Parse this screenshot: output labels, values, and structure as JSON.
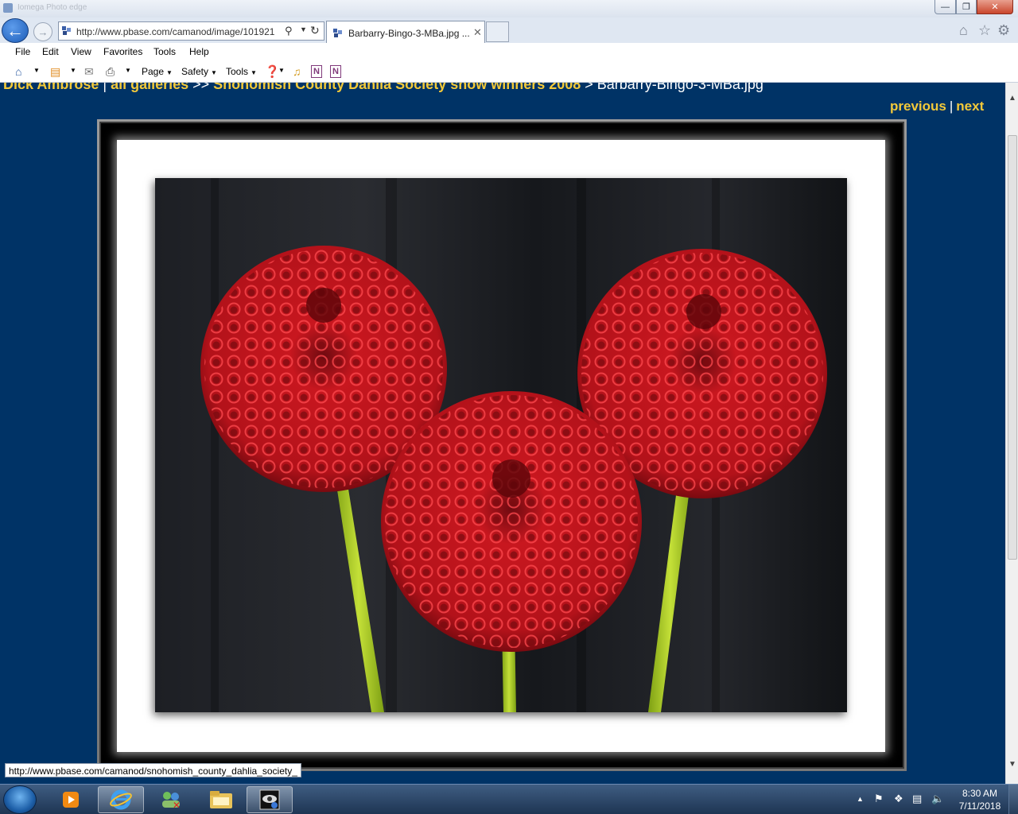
{
  "browser": {
    "title_ghost": "Iomega Photo edge",
    "address_url": "http://www.pbase.com/camanod/image/101921",
    "tab_title": "Barbarry-Bingo-3-MBa.jpg ...",
    "menu": [
      "File",
      "Edit",
      "View",
      "Favorites",
      "Tools",
      "Help"
    ],
    "commands": {
      "page": "Page",
      "safety": "Safety",
      "tools": "Tools"
    }
  },
  "page": {
    "breadcrumb": {
      "owner": "Dick Ambrose",
      "sep1": " | ",
      "all_galleries": "all galleries",
      "sep2": " >> ",
      "gallery": "Snohomish County Dahlia Society show winners 2008",
      "sep3": " > ",
      "current": "Barbarry-Bingo-3-MBa.jpg"
    },
    "previous": "previous",
    "pipe": "|",
    "next": "next"
  },
  "status_url": "http://www.pbase.com/camanod/snohomish_county_dahlia_society_",
  "taskbar": {
    "clock_time": "8:30 AM",
    "clock_date": "7/11/2018"
  },
  "colors": {
    "page_background": "#003366",
    "link": "#f3c93a",
    "flower_red": "#c0141c",
    "stem_green": "#9bc41e"
  }
}
